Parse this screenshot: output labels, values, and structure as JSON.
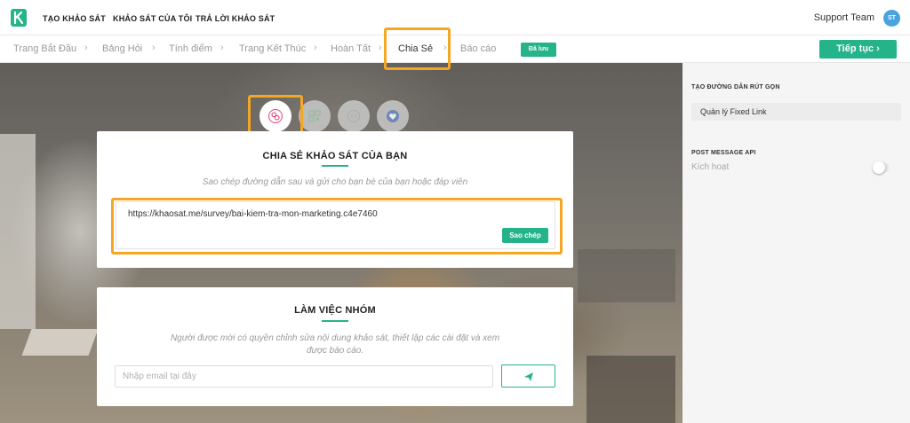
{
  "nav": {
    "links": [
      "TẠO KHẢO SÁT",
      "KHẢO SÁT CỦA TÔI",
      "TRẢ LỜI KHẢO SÁT"
    ],
    "user_name": "Support Team",
    "avatar_initials": "ST"
  },
  "steps": {
    "items": [
      "Trang Bắt Đầu",
      "Bảng Hỏi",
      "Tính điểm",
      "Trang Kết Thúc",
      "Hoàn Tất",
      "Chia Sẻ",
      "Báo cáo"
    ],
    "active": "Chia Sẻ",
    "separator": "›",
    "saved_badge": "Đã lưu",
    "continue_label": "Tiếp tục ›"
  },
  "share_tabs": [
    "link-icon",
    "qr-code-icon",
    "embed-icon",
    "social-icon"
  ],
  "share_card": {
    "title": "CHIA SẺ KHẢO SÁT CỦA BẠN",
    "description": "Sao chép đường dẫn sau và gửi cho bạn bè của bạn hoặc đáp viên",
    "link": "https://khaosat.me/survey/bai-kiem-tra-mon-marketing.c4e7460",
    "copy_label": "Sao chép"
  },
  "team_card": {
    "title": "LÀM VIỆC NHÓM",
    "description_line1": "Người được mời có quyền chỉnh sửa nội dung khảo sát, thiết lập các cài đặt và xem",
    "description_line2": "được báo cáo.",
    "email_placeholder": "Nhập email tại đây",
    "send_icon": "paper-plane-icon"
  },
  "side": {
    "short_link_label": "TẠO ĐƯỜNG DẪN RÚT GỌN",
    "fixed_link_label": "Quản lý Fixed Link",
    "post_message_label": "POST MESSAGE API",
    "activate_label": "Kích hoạt",
    "activate_on": false
  },
  "colors": {
    "accent": "#25b389",
    "highlight": "#f5a623",
    "avatar": "#4aa3df"
  }
}
